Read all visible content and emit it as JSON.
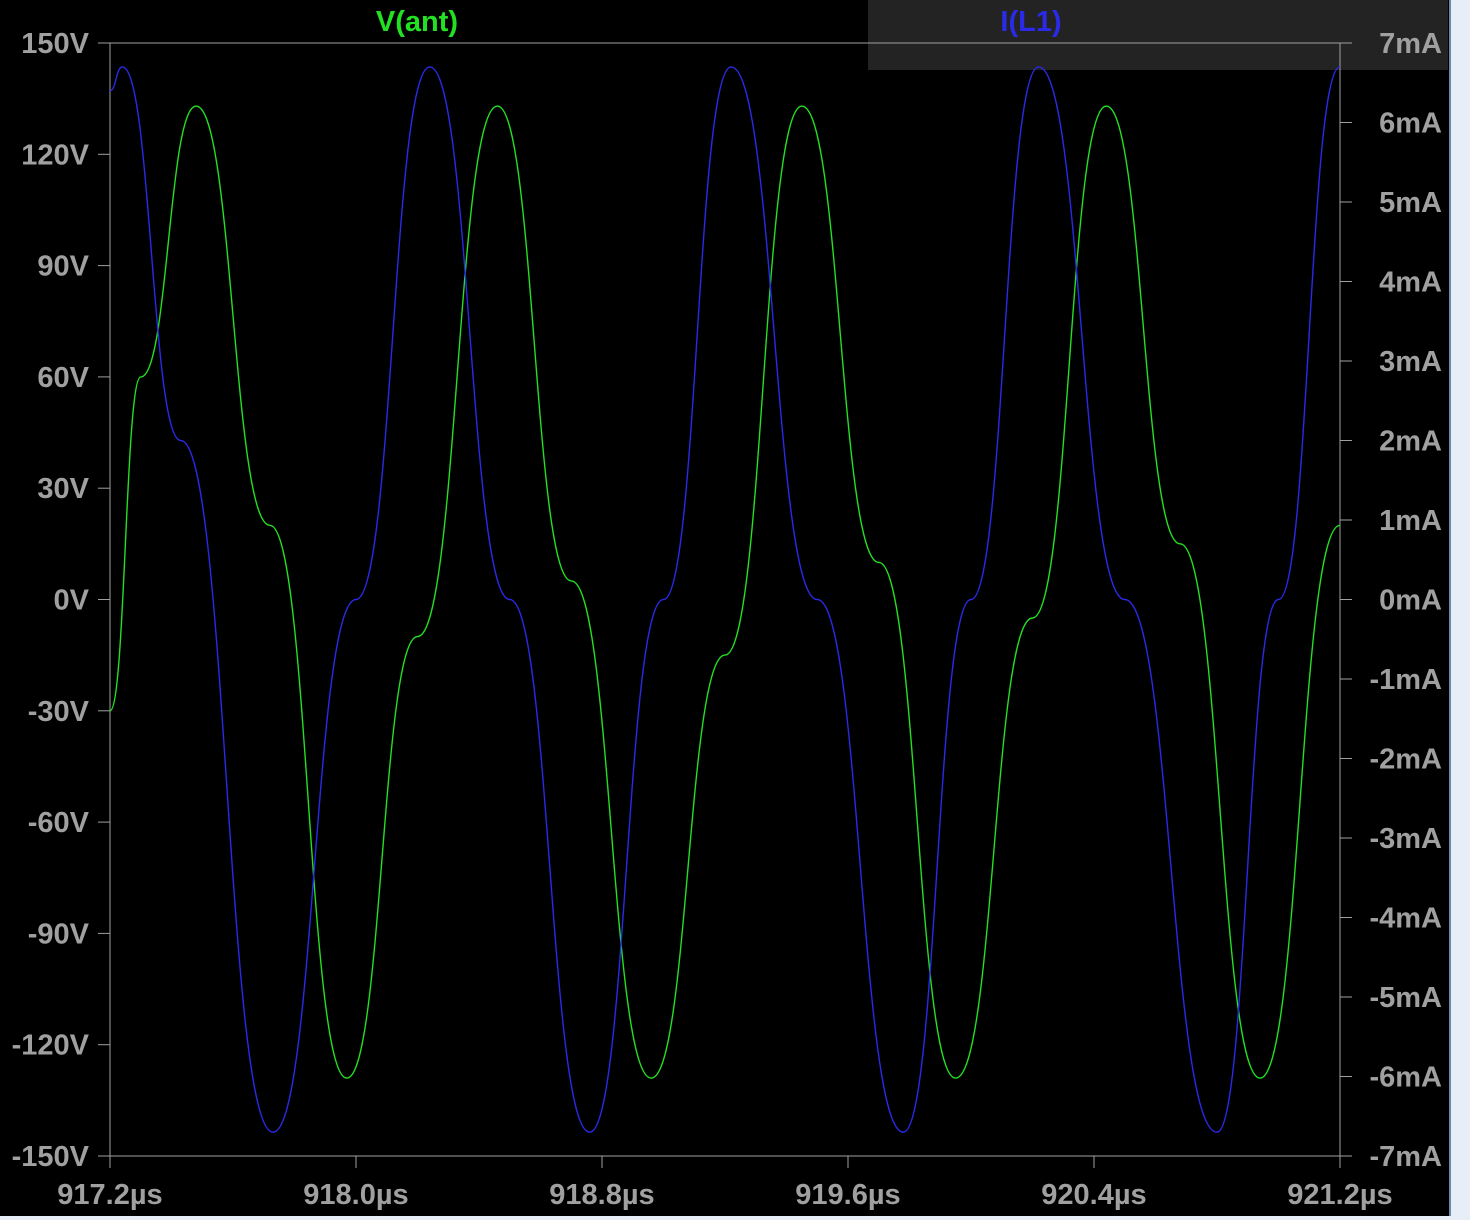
{
  "colors": {
    "background": "#000000",
    "axis": "#a0a0a0",
    "v_ant": "#22e022",
    "i_l1": "#2a2ae8",
    "legend_bar": "#232323"
  },
  "legend": {
    "left_label": "V(ant)",
    "right_label": "I(L1)"
  },
  "chart_data": {
    "type": "line",
    "x_unit": "µs",
    "xlim": [
      917.2,
      921.2
    ],
    "x_ticks": [
      917.2,
      918.0,
      918.8,
      919.6,
      920.4,
      921.2
    ],
    "x_tick_labels": [
      "917.2µs",
      "918.0µs",
      "918.8µs",
      "919.6µs",
      "920.4µs",
      "921.2µs"
    ],
    "y_left": {
      "unit": "V",
      "lim": [
        -150,
        150
      ],
      "ticks": [
        150,
        120,
        90,
        60,
        30,
        0,
        -30,
        -60,
        -90,
        -120,
        -150
      ],
      "tick_labels": [
        "150V",
        "120V",
        "90V",
        "60V",
        "30V",
        "0V",
        "-30V",
        "-60V",
        "-90V",
        "-120V",
        "-150V"
      ]
    },
    "y_right": {
      "unit": "mA",
      "lim": [
        -7,
        7
      ],
      "ticks": [
        7,
        6,
        5,
        4,
        3,
        2,
        1,
        0,
        -1,
        -2,
        -3,
        -4,
        -5,
        -6,
        -7
      ],
      "tick_labels": [
        "7mA",
        "6mA",
        "5mA",
        "4mA",
        "3mA",
        "2mA",
        "1mA",
        "0mA",
        "-1mA",
        "-2mA",
        "-3mA",
        "-4mA",
        "-5mA",
        "-6mA",
        "-7mA"
      ]
    },
    "series": [
      {
        "name": "V(ant)",
        "axis": "left",
        "unit": "V",
        "color": "#22e022",
        "x": [
          917.2,
          917.3,
          917.48,
          917.72,
          917.97,
          918.2,
          918.46,
          918.7,
          918.96,
          919.2,
          919.45,
          919.7,
          919.95,
          920.2,
          920.44,
          920.68,
          920.94,
          921.2
        ],
        "values": [
          -30,
          60,
          133,
          20,
          -129,
          -10,
          133,
          5,
          -129,
          -15,
          133,
          10,
          -129,
          -5,
          133,
          15,
          -129,
          20
        ]
      },
      {
        "name": "I(L1)",
        "axis": "right",
        "unit": "mA",
        "color": "#2a2ae8",
        "x": [
          917.2,
          917.24,
          917.43,
          917.73,
          918.0,
          918.24,
          918.5,
          918.76,
          919.0,
          919.22,
          919.5,
          919.78,
          920.0,
          920.22,
          920.5,
          920.8,
          921.0,
          921.2
        ],
        "values": [
          6.4,
          6.7,
          2.0,
          -6.7,
          0.0,
          6.7,
          0.0,
          -6.7,
          0.0,
          6.7,
          0.0,
          -6.7,
          0.0,
          6.7,
          0.0,
          -6.7,
          0.0,
          6.7
        ]
      }
    ]
  }
}
